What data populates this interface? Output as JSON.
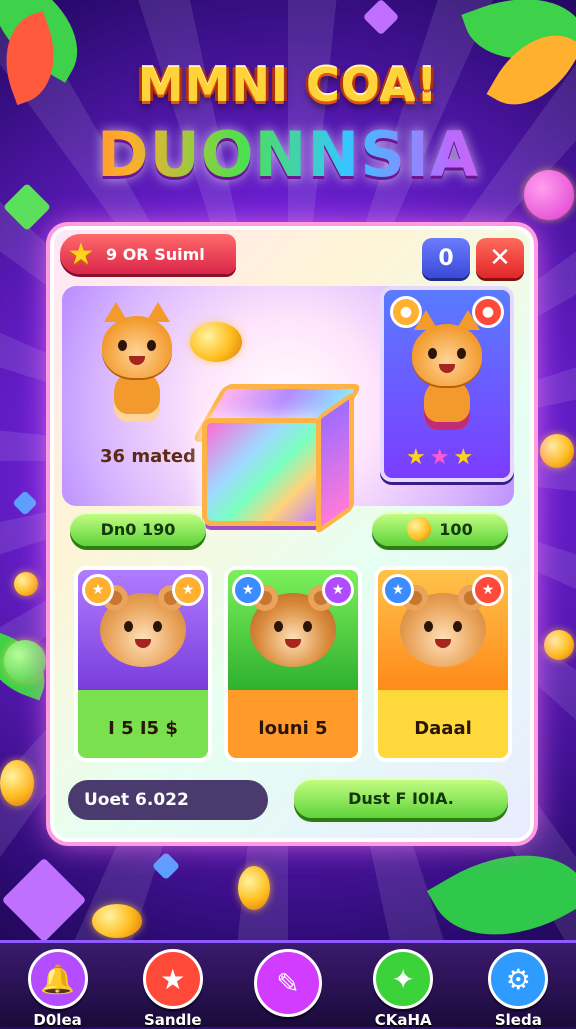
{
  "header": {
    "title_line1": "MMNI COA!",
    "title_line2": "DUONNSIA"
  },
  "panel": {
    "badge_text": "9 OR Suiml",
    "counter_value": "0",
    "close_symbol": "✕",
    "hero_label": "mated",
    "hero_label_prefix": "36",
    "left_pill_text": "Dn0 190",
    "right_pill_text": "100",
    "star_rating": 3
  },
  "pets": [
    {
      "label": "I 5 I5 $",
      "bg": "#9a4dff",
      "label_bg": "#7be04d"
    },
    {
      "label": "louni 5",
      "bg": "#4fd13a",
      "label_bg": "#ff9a2b"
    },
    {
      "label": "Daaal",
      "bg": "#ff9a1f",
      "label_bg": "#ffd93b"
    }
  ],
  "bottom": {
    "stat_text": "Uoet 6.022",
    "action_text": "Dust F I0IA."
  },
  "nav": [
    {
      "label": "D0lea",
      "icon": "bell-icon",
      "color": "#b44cff"
    },
    {
      "label": "Sandle",
      "icon": "star-icon",
      "color": "#ff4a3a"
    },
    {
      "label": "",
      "icon": "wand-icon",
      "color": "#d23cff"
    },
    {
      "label": "CKaHA",
      "icon": "spark-icon",
      "color": "#3cd23a"
    },
    {
      "label": "Sleda",
      "icon": "gear-icon",
      "color": "#2f9bff"
    }
  ]
}
